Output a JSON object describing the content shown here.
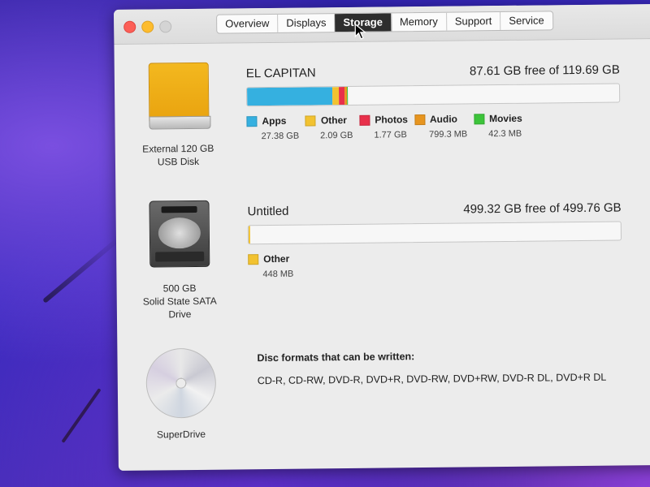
{
  "tabs": [
    {
      "label": "Overview"
    },
    {
      "label": "Displays"
    },
    {
      "label": "Storage"
    },
    {
      "label": "Memory"
    },
    {
      "label": "Support"
    },
    {
      "label": "Service"
    }
  ],
  "active_tab": "Storage",
  "devices": [
    {
      "label": "External 120 GB\nUSB Disk",
      "icon": "external-drive-icon"
    },
    {
      "label": "500 GB\nSolid State SATA\nDrive",
      "icon": "hard-drive-icon"
    },
    {
      "label": "SuperDrive",
      "icon": "optical-disc-icon"
    }
  ],
  "volumes": [
    {
      "name": "EL CAPITAN",
      "capacity": "87.61 GB free of 119.69 GB",
      "categories": [
        {
          "name": "Apps",
          "size": "27.38 GB",
          "color": "#35b0e0",
          "fraction": 0.2288
        },
        {
          "name": "Other",
          "size": "2.09 GB",
          "color": "#f2c230",
          "fraction": 0.0175
        },
        {
          "name": "Photos",
          "size": "1.77 GB",
          "color": "#e8304a",
          "fraction": 0.0148
        },
        {
          "name": "Audio",
          "size": "799.3 MB",
          "color": "#e7951f",
          "fraction": 0.0067
        },
        {
          "name": "Movies",
          "size": "42.3 MB",
          "color": "#3cc43a",
          "fraction": 0.0004
        }
      ]
    },
    {
      "name": "Untitled",
      "capacity": "499.32 GB free of 499.76 GB",
      "categories": [
        {
          "name": "Other",
          "size": "448 MB",
          "color": "#f2c230",
          "fraction": 0.0009
        }
      ]
    }
  ],
  "superdrive": {
    "title": "Disc formats that can be written:",
    "formats": "CD-R, CD-RW, DVD-R, DVD+R, DVD-RW, DVD+RW, DVD-R DL, DVD+R DL"
  }
}
